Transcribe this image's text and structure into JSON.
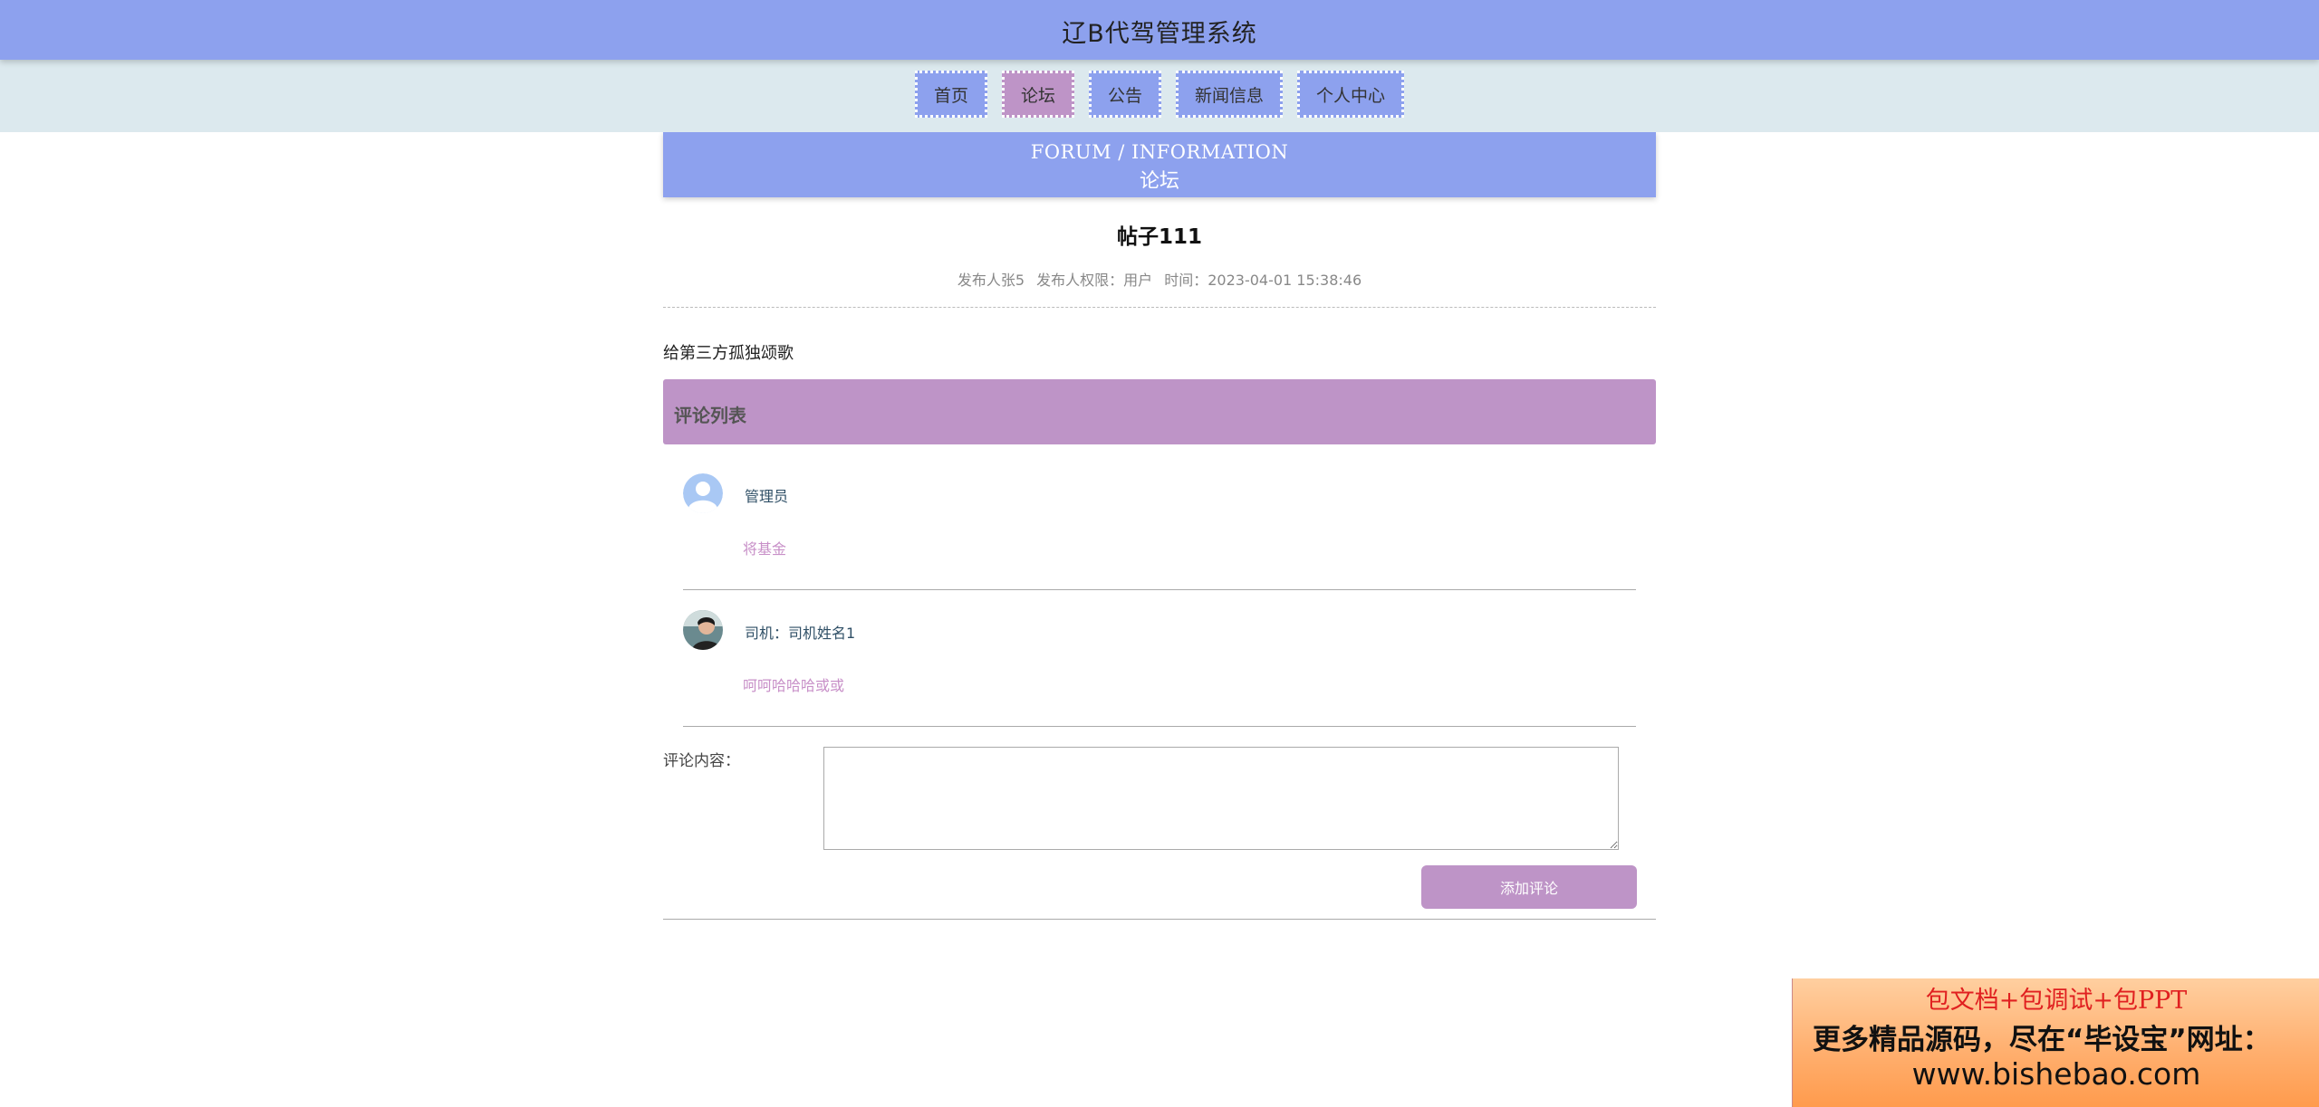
{
  "header": {
    "title": "辽B代驾管理系统"
  },
  "nav": {
    "items": [
      {
        "label": "首页"
      },
      {
        "label": "论坛"
      },
      {
        "label": "公告"
      },
      {
        "label": "新闻信息"
      },
      {
        "label": "个人中心"
      }
    ],
    "active": "论坛"
  },
  "banner": {
    "subtitle_en": "FORUM / INFORMATION",
    "title": "论坛"
  },
  "post": {
    "title": "帖子111",
    "author": "发布人张5",
    "role": "发布人权限：用户",
    "time": "时间：2023-04-01 15:38:46",
    "content": "给第三方孤独颂歌"
  },
  "comments": {
    "header": "评论列表",
    "items": [
      {
        "name": "管理员",
        "text": "将基金",
        "avatar_icon": "default-user-avatar-icon"
      },
      {
        "name": "司机：司机姓名1",
        "text": "呵呵哈哈哈或或",
        "avatar_icon": "photo-avatar-icon"
      }
    ]
  },
  "form": {
    "label": "评论内容：",
    "placeholder": "",
    "submit_label": "添加评论"
  },
  "ad": {
    "line1": "包文档+包调试+包PPT",
    "line2": "更多精品源码，尽在“毕设宝”网址：",
    "line3": "www.bishebao.com"
  },
  "colors": {
    "header_blue": "#8da1ee",
    "nav_bg": "#dce9ee",
    "accent_purple": "#be94c7",
    "comment_text": "#c890c8"
  }
}
